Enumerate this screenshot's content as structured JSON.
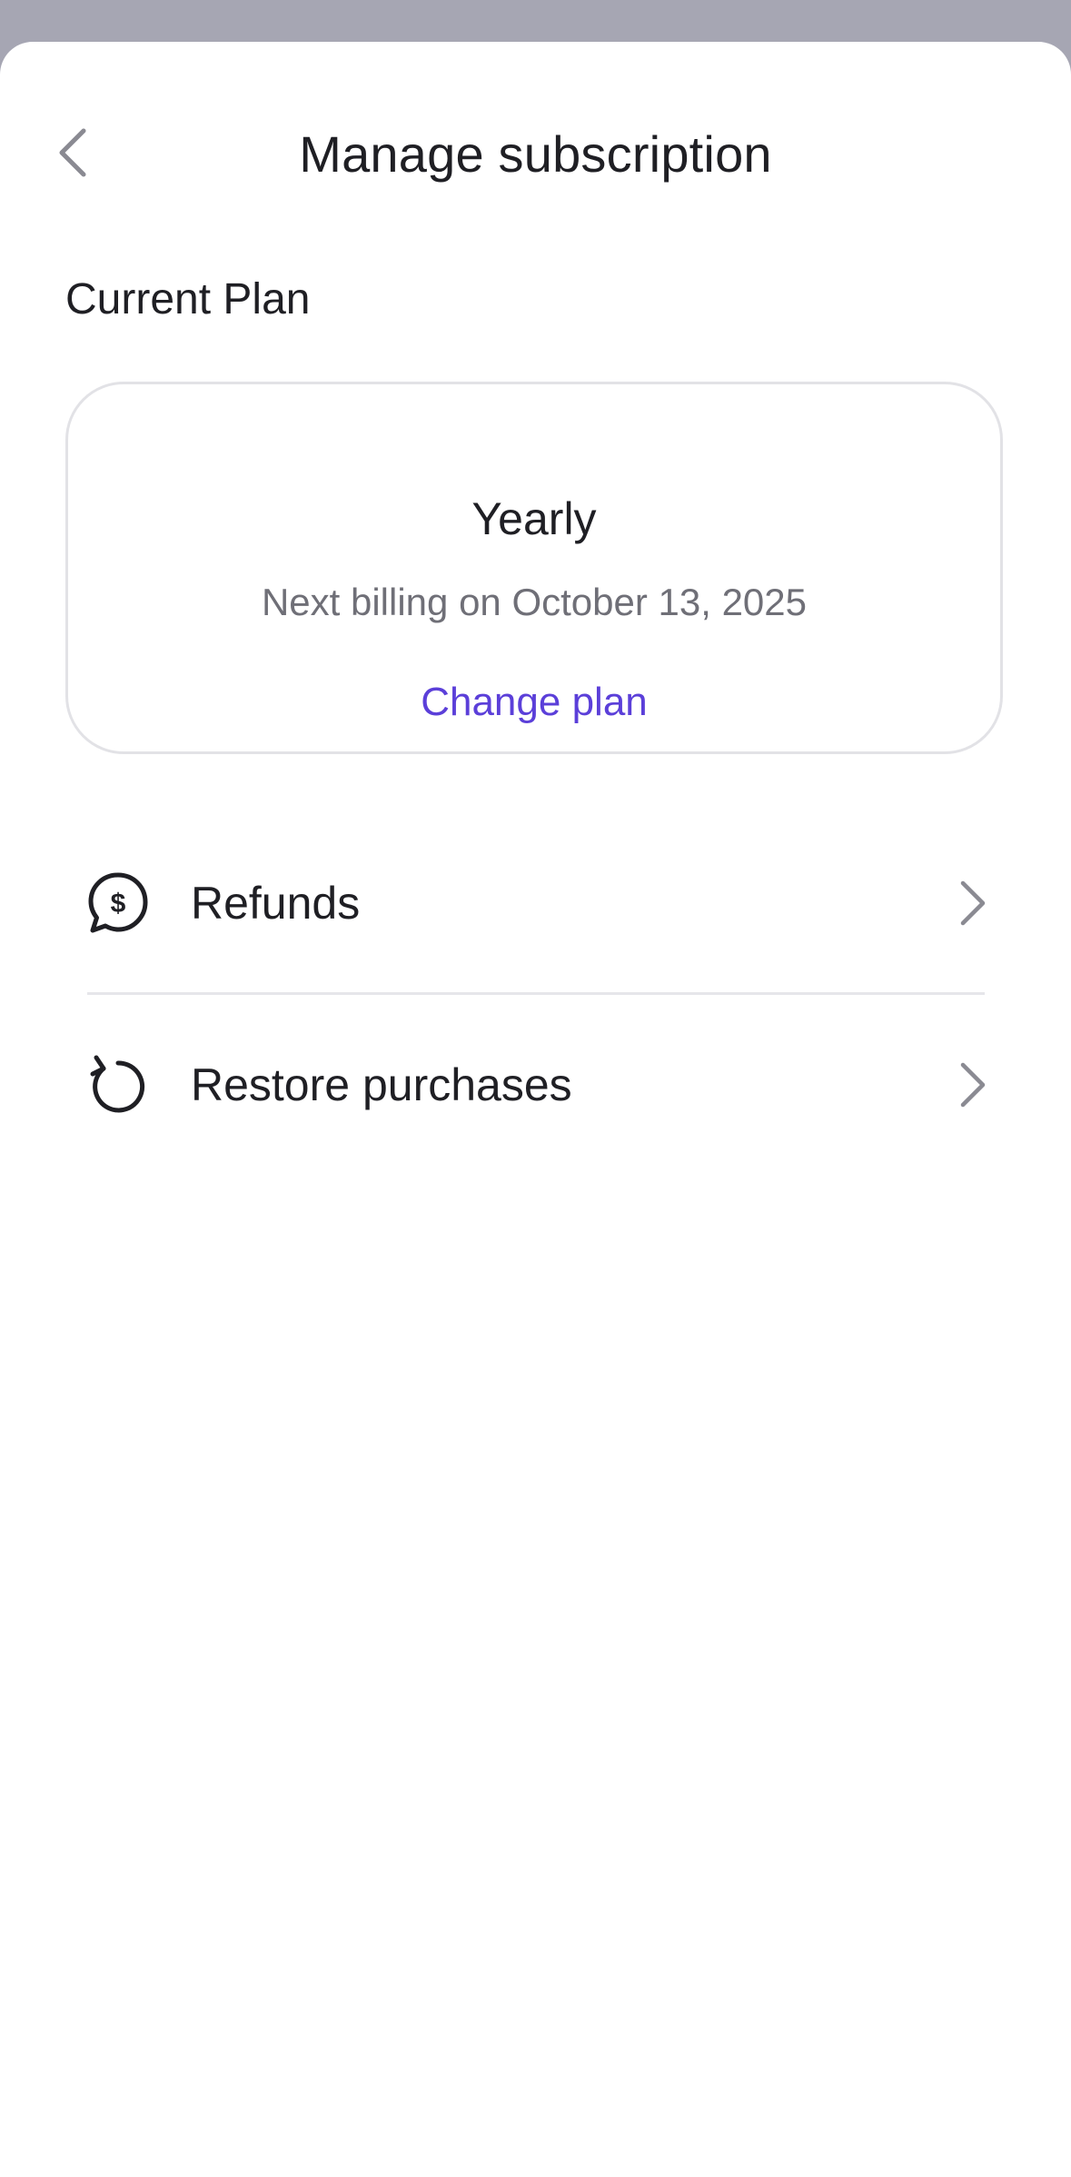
{
  "header": {
    "title": "Manage subscription",
    "back_icon": "chevron-left-icon"
  },
  "current_plan": {
    "section_title": "Current Plan",
    "plan_name": "Yearly",
    "billing_text": "Next billing on October 13, 2025",
    "change_plan_label": "Change plan"
  },
  "options": [
    {
      "label": "Refunds",
      "icon": "dollar-chat-bubble-icon"
    },
    {
      "label": "Restore purchases",
      "icon": "restore-arrow-icon"
    }
  ],
  "colors": {
    "accent": "#5b3fd9",
    "overlay": "#a6a6b3",
    "text_primary": "#1f1f24",
    "text_secondary": "#6f6f77",
    "border": "#e2e2e6"
  }
}
